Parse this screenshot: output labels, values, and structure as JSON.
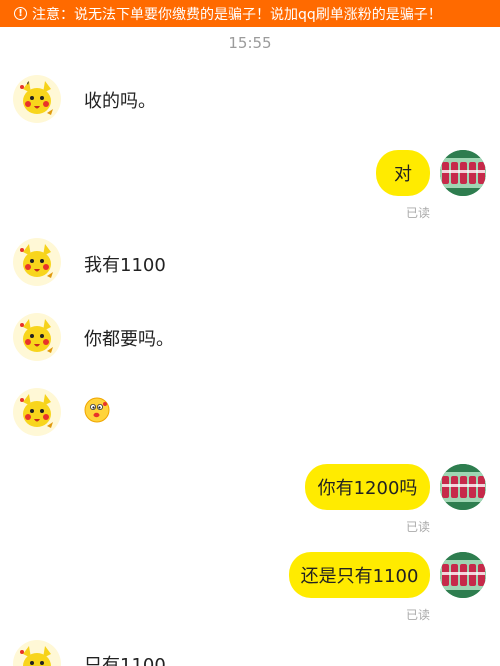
{
  "notice": {
    "icon": "alert-circle-icon",
    "text": "注意：说无法下单要你缴费的是骗子！说加qq刷单涨粉的是骗子！",
    "color": "#ff6a00"
  },
  "time": "15:55",
  "colors": {
    "bubble": "#ffeb00",
    "read": "#aaaaaa"
  },
  "messages": [
    {
      "side": "left",
      "text": "收的吗。"
    },
    {
      "side": "right",
      "text": "对",
      "status": "已读"
    },
    {
      "side": "left",
      "text": "我有1100"
    },
    {
      "side": "left",
      "text": "你都要吗。"
    },
    {
      "side": "left",
      "text": "",
      "sticker": "face-emoji-icon"
    },
    {
      "side": "right",
      "text": "你有1200吗",
      "status": "已读"
    },
    {
      "side": "right",
      "text": "还是只有1100",
      "status": "已读"
    },
    {
      "side": "left",
      "text": "只有1100"
    }
  ]
}
